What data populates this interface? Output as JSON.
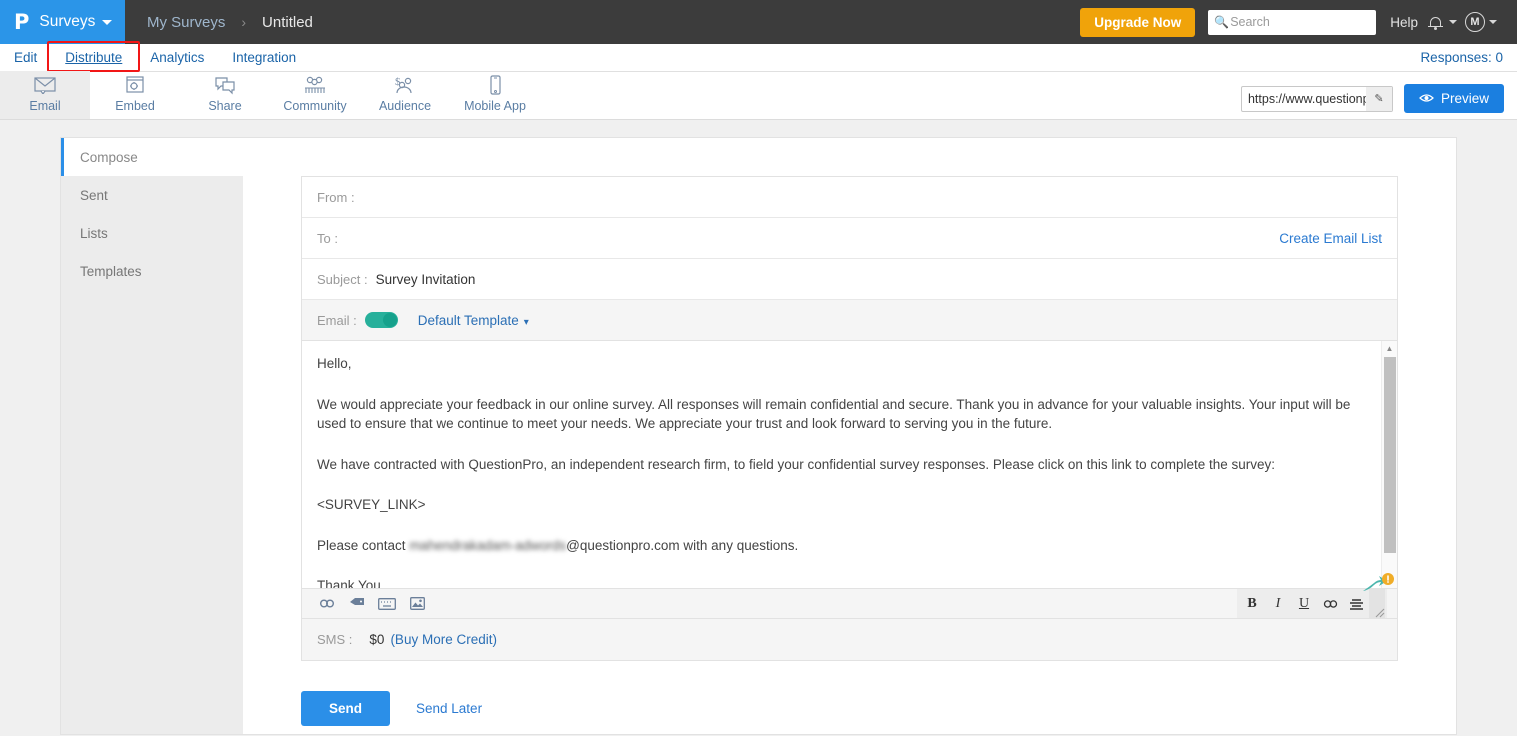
{
  "topbar": {
    "logo_glyph": "P",
    "brand": "Surveys",
    "breadcrumb_parent": "My Surveys",
    "breadcrumb_sep": "›",
    "breadcrumb_current": "Untitled",
    "upgrade_label": "Upgrade Now",
    "search_placeholder": "Search",
    "search_value": "",
    "search_icon": "search-icon",
    "help_label": "Help",
    "bell_icon": "bell-icon",
    "avatar_initial": "M"
  },
  "tabs": {
    "items": [
      {
        "label": "Edit",
        "active": false
      },
      {
        "label": "Distribute",
        "active": true
      },
      {
        "label": "Analytics",
        "active": false
      },
      {
        "label": "Integration",
        "active": false
      }
    ],
    "highlight_color": "#f21616",
    "responses_label": "Responses: 0"
  },
  "channels": {
    "items": [
      {
        "label": "Email",
        "icon": "envelope-icon",
        "active": true
      },
      {
        "label": "Embed",
        "icon": "embed-code-icon",
        "active": false
      },
      {
        "label": "Share",
        "icon": "share-speech-bubbles-icon",
        "active": false
      },
      {
        "label": "Community",
        "icon": "community-people-icon",
        "active": false
      },
      {
        "label": "Audience",
        "icon": "audience-dollar-people-icon",
        "active": false
      },
      {
        "label": "Mobile App",
        "icon": "mobile-phone-icon",
        "active": false
      }
    ],
    "survey_url": "https://www.questionpro.com/t/APITFZe",
    "edit_icon": "pencil-icon",
    "preview_label": "Preview",
    "preview_icon": "eye-icon"
  },
  "sidebar": {
    "items": [
      {
        "label": "Compose",
        "active": true
      },
      {
        "label": "Sent",
        "active": false
      },
      {
        "label": "Lists",
        "active": false
      },
      {
        "label": "Templates",
        "active": false
      }
    ]
  },
  "compose": {
    "from_label": "From :",
    "from_value": "",
    "to_label": "To :",
    "to_value": "",
    "create_list_label": "Create Email List",
    "subject_label": "Subject :",
    "subject_value": "Survey Invitation",
    "email_toggle_label": "Email :",
    "email_toggle_on": true,
    "template_label": "Default Template",
    "template_caret": "⌄",
    "body": {
      "greeting": "Hello,",
      "paragraph1": "We would appreciate your feedback in our online survey.  All responses will remain confidential and secure.  Thank you in advance for your valuable insights.  Your input will be used to ensure that we continue to meet your needs. We appreciate your trust and look forward to serving you in the future.",
      "paragraph2": "We have contracted with QuestionPro, an independent research firm, to field your confidential survey responses.  Please click on this link to complete the survey:",
      "survey_link_token": "<SURVEY_LINK>",
      "contact_prefix": "Please contact ",
      "contact_redacted": "mahendrakadam-adwords",
      "contact_suffix": "@questionpro.com with any questions.",
      "signoff": "Thank You"
    },
    "toolbar_left": [
      {
        "icon": "link-icon",
        "glyph": "⚭"
      },
      {
        "icon": "tag-icon",
        "glyph": "➤"
      },
      {
        "icon": "keyboard-icon",
        "glyph": "⌨"
      },
      {
        "icon": "image-icon",
        "glyph": "▣"
      }
    ],
    "toolbar_right": [
      {
        "icon": "bold-icon",
        "glyph": "B"
      },
      {
        "icon": "italic-icon",
        "glyph": "I"
      },
      {
        "icon": "underline-icon",
        "glyph": "U"
      },
      {
        "icon": "insert-link-icon",
        "glyph": "⚭"
      },
      {
        "icon": "align-icon",
        "glyph": "≡"
      }
    ],
    "editor_badge_icon": "warning-badge-icon",
    "resize_grip_icon": "resize-grip-icon",
    "scrollbar_up_icon": "scroll-up-arrow-icon",
    "sms_label": "SMS :",
    "sms_amount": "$0",
    "sms_credit_label": "(Buy More Credit)",
    "send_label": "Send",
    "send_later_label": "Send Later"
  }
}
